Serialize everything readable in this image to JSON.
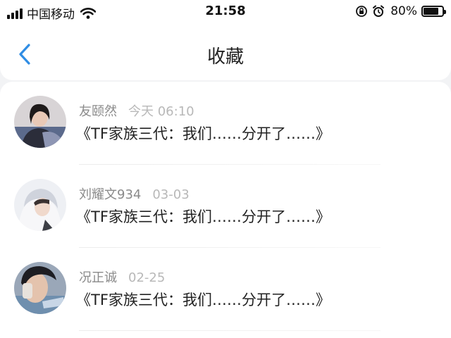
{
  "status_bar": {
    "carrier": "中国移动",
    "time": "21:58",
    "battery_percent": "80%",
    "battery_level": 0.8,
    "icons": [
      "signal-icon",
      "wifi-icon",
      "orientation-lock-icon",
      "alarm-icon",
      "battery-icon"
    ]
  },
  "header": {
    "back_icon": "chevron-left-icon",
    "title": "收藏"
  },
  "favorites": [
    {
      "user": "友颐然",
      "time": "今天 06:10",
      "title": "《TF家族三代：我们……分开了……》"
    },
    {
      "user": "刘耀文934",
      "time": "03-03",
      "title": "《TF家族三代：我们……分开了……》"
    },
    {
      "user": "况正诚",
      "time": "02-25",
      "title": "《TF家族三代：我们……分开了……》"
    }
  ],
  "colors": {
    "accent": "#2f8de4",
    "background": "#f2f3f5",
    "username": "#8a8a8a",
    "timestamp": "#b8b8b8",
    "title_text": "#222222"
  }
}
